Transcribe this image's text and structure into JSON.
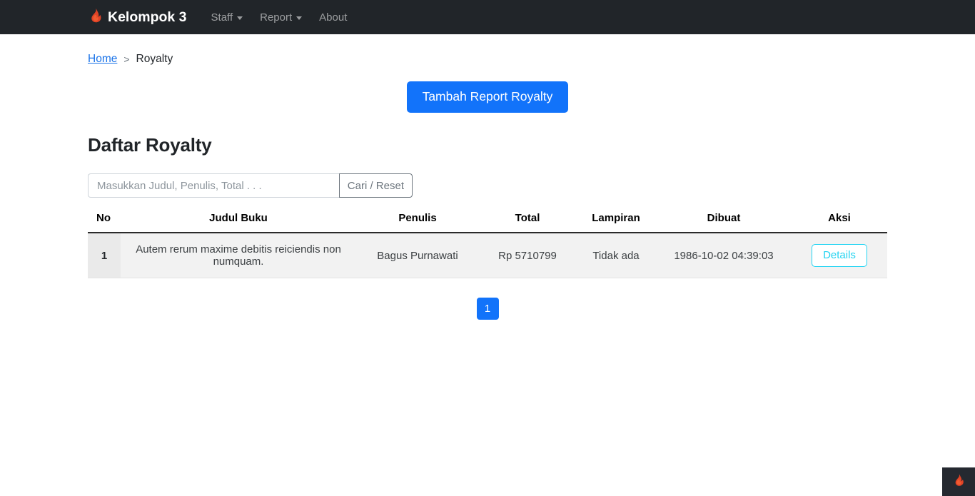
{
  "colors": {
    "navbar_bg": "#212529",
    "brand_flame": "#e04326",
    "primary": "#1273fa",
    "link": "#1a73e8",
    "details_cyan": "#23d3f0",
    "row_bg": "#f2f2f2",
    "muted": "#6c757d"
  },
  "navbar": {
    "brand": "Kelompok 3",
    "brand_icon": "flame-icon",
    "items": [
      {
        "label": "Staff",
        "has_dropdown": true
      },
      {
        "label": "Report",
        "has_dropdown": true
      },
      {
        "label": "About",
        "has_dropdown": false
      }
    ]
  },
  "breadcrumb": {
    "home": "Home",
    "separator": ">",
    "current": "Royalty"
  },
  "actions": {
    "add_label": "Tambah Report Royalty"
  },
  "page": {
    "title": "Daftar Royalty"
  },
  "search": {
    "value": "",
    "placeholder": "Masukkan Judul, Penulis, Total . . .",
    "button_label": "Cari / Reset"
  },
  "table": {
    "headers": {
      "no": "No",
      "judul": "Judul Buku",
      "penulis": "Penulis",
      "total": "Total",
      "lampiran": "Lampiran",
      "dibuat": "Dibuat",
      "aksi": "Aksi"
    },
    "rows": [
      {
        "no": "1",
        "judul": "Autem rerum maxime debitis reiciendis non numquam.",
        "penulis": "Bagus Purnawati",
        "total": "Rp 5710799",
        "lampiran": "Tidak ada",
        "dibuat": "1986-10-02 04:39:03",
        "aksi_label": "Details"
      }
    ]
  },
  "pagination": {
    "pages": [
      {
        "label": "1",
        "active": true
      }
    ]
  },
  "debug_widget": {
    "icon": "flame-icon"
  }
}
